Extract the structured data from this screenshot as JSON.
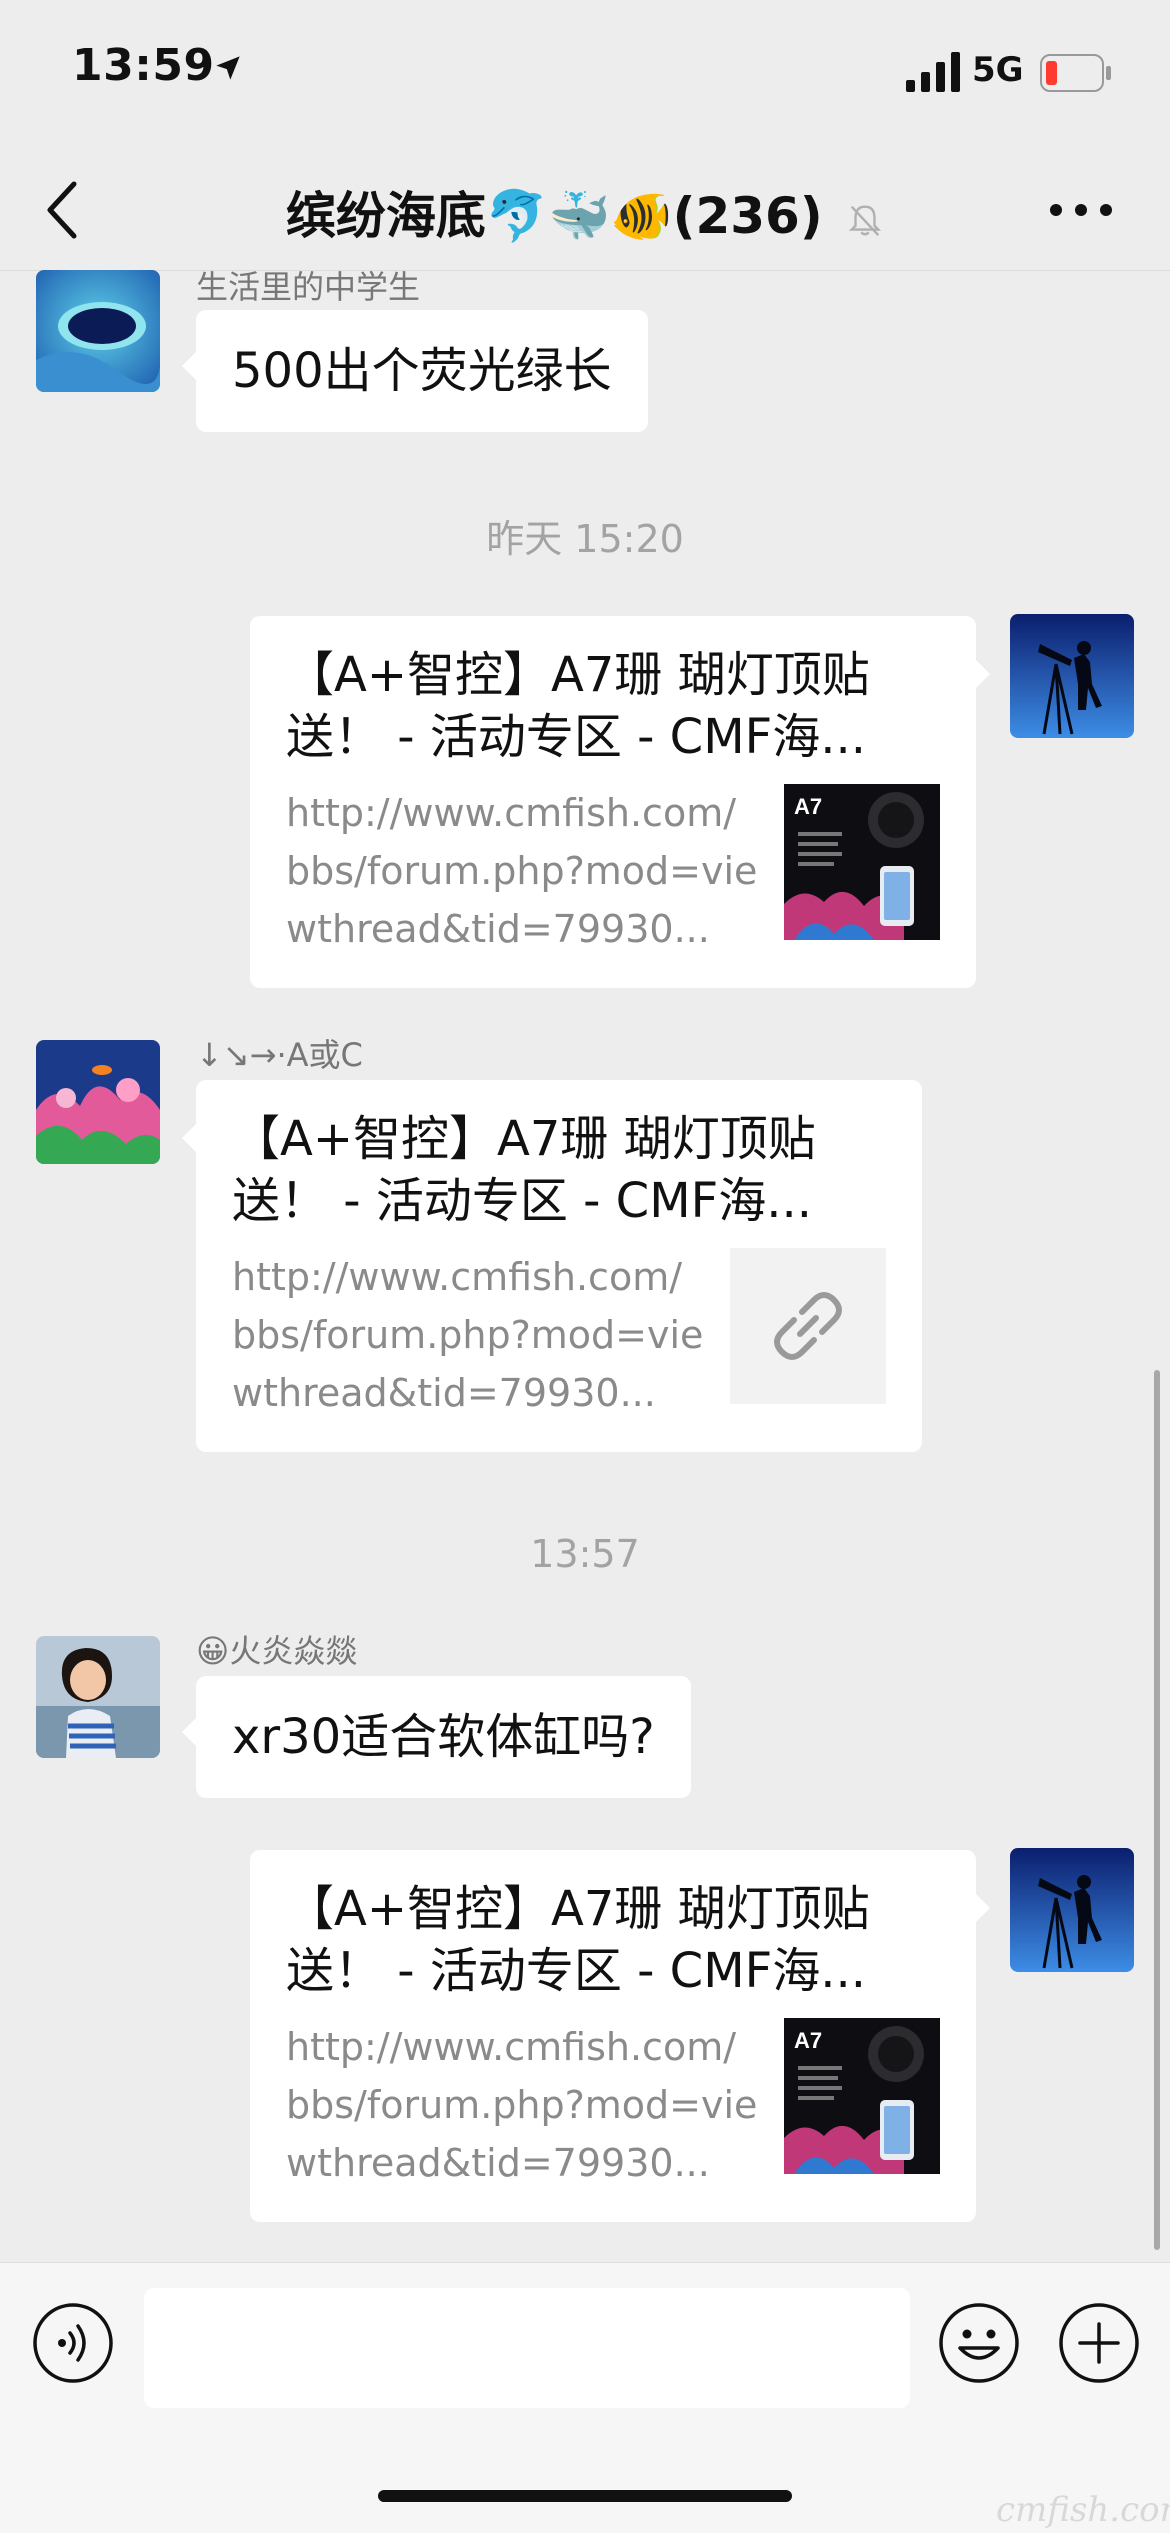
{
  "status_bar": {
    "time": "13:59",
    "network": "5G",
    "battery_color": "#ff3b30"
  },
  "header": {
    "title": "缤纷海底🐬🐳🐠(236)",
    "muted_icon": "bell-slash-icon",
    "more_icon": "more-dots-icon",
    "back_icon": "chevron-left-icon"
  },
  "messages": [
    {
      "side": "left",
      "sender": "生活里的中学生",
      "text": "500出个荧光绿长",
      "avatar": "blue-hole-avatar"
    },
    {
      "timestamp": "昨天 15:20"
    },
    {
      "side": "right",
      "card": {
        "title": "【A+智控】A7珊 瑚灯顶贴送！ - 活动专区 - CMF海...",
        "desc": "http://www.cmfish.com/bbs/forum.php?mod=viewthread&tid=79930...",
        "thumb_label": "A7"
      },
      "avatar": "telescope-avatar"
    },
    {
      "side": "left",
      "sender": "↓↘→·A或C",
      "card": {
        "title": "【A+智控】A7珊 瑚灯顶贴送！ - 活动专区 - CMF海...",
        "desc": "http://www.cmfish.com/bbs/forum.php?mod=viewthread&tid=79930...",
        "thumb_icon": "link-icon"
      },
      "avatar": "coral-avatar"
    },
    {
      "timestamp": "13:57"
    },
    {
      "side": "left",
      "sender": "😀火炎焱燚",
      "text": "xr30适合软体缸吗?",
      "avatar": "child-avatar"
    },
    {
      "side": "right",
      "card": {
        "title": "【A+智控】A7珊 瑚灯顶贴送！ - 活动专区 - CMF海...",
        "desc": "http://www.cmfish.com/bbs/forum.php?mod=viewthread&tid=79930...",
        "thumb_label": "A7"
      },
      "avatar": "telescope-avatar"
    }
  ],
  "input_bar": {
    "voice_icon": "voice-icon",
    "emoji_icon": "emoji-icon",
    "plus_icon": "plus-icon"
  },
  "watermark": "cmfish.com"
}
